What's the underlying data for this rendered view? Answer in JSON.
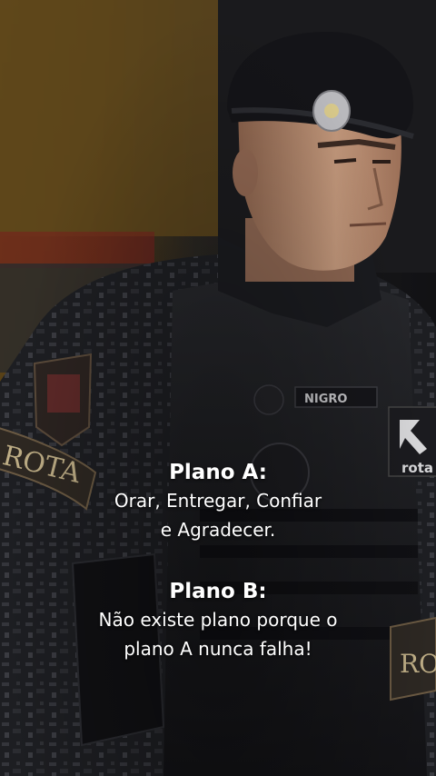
{
  "image": {
    "subject": "soldier-photo",
    "colors": {
      "background_dark": "#141417",
      "wall_gold": "#6b4f1c",
      "uniform": "#1f2024",
      "beret": "#141418",
      "skin": "#b98d72",
      "caption_text": "#ffffff"
    },
    "patches": {
      "shoulder_tab": "ROTA",
      "name_tape": "NIGRO",
      "chest_logo": "rota",
      "lower_tab": "RO"
    }
  },
  "caption": {
    "plan_a": {
      "title": "Plano A:",
      "lines": [
        "Orar, Entregar, Confiar",
        "e Agradecer."
      ]
    },
    "plan_b": {
      "title": "Plano B:",
      "lines": [
        "Não existe plano porque o",
        "plano A nunca falha!"
      ]
    }
  }
}
